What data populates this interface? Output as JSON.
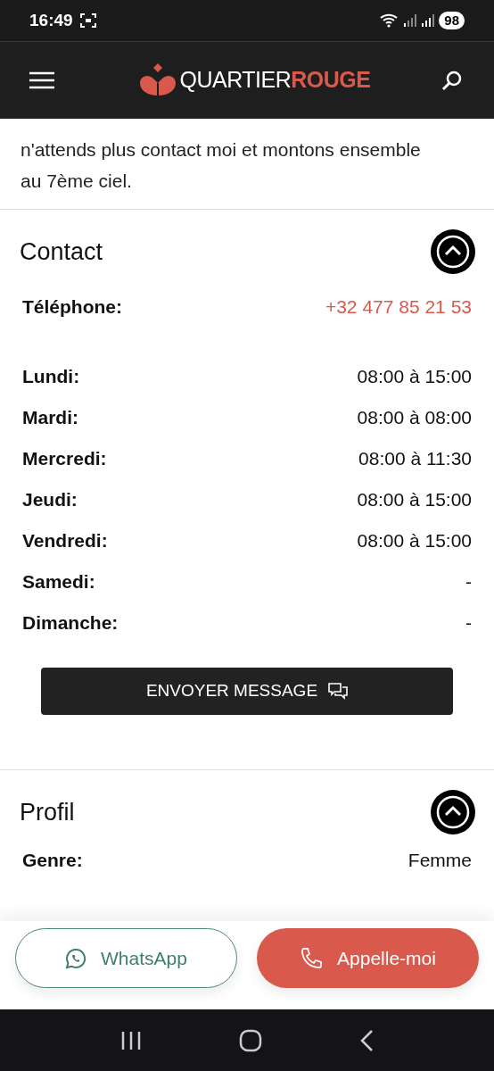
{
  "status_bar": {
    "time": "16:49",
    "battery": "98"
  },
  "header": {
    "logo_light": "QUARTIER",
    "logo_bold": "ROUGE"
  },
  "description": [
    "n'attends plus contact moi et montons ensemble",
    "au 7ème ciel."
  ],
  "contact": {
    "title": "Contact",
    "expanded": true,
    "phone": {
      "label": "Téléphone:",
      "value": "+32 477 85 21 53"
    },
    "hours": [
      {
        "day": "Lundi:",
        "time": "08:00 à 15:00"
      },
      {
        "day": "Mardi:",
        "time": "08:00 à 08:00"
      },
      {
        "day": "Mercredi:",
        "time": "08:00 à 11:30"
      },
      {
        "day": "Jeudi:",
        "time": "08:00 à 15:00"
      },
      {
        "day": "Vendredi:",
        "time": "08:00 à 15:00"
      },
      {
        "day": "Samedi:",
        "time": "-"
      },
      {
        "day": "Dimanche:",
        "time": "-"
      }
    ],
    "button": "ENVOYER MESSAGE"
  },
  "profile": {
    "title": "Profil",
    "expanded": true,
    "rows": [
      {
        "label": "Genre:",
        "value": "Femme"
      }
    ]
  },
  "actions": [
    {
      "kind": "whatsapp",
      "label": "WhatsApp"
    },
    {
      "kind": "call",
      "label": "Appelle-moi"
    }
  ]
}
